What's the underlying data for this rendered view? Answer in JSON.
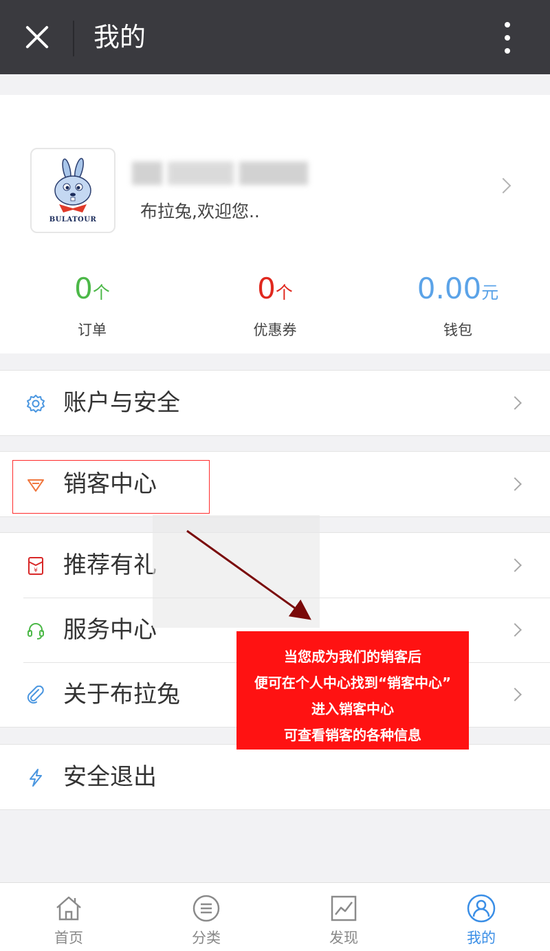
{
  "topbar": {
    "title": "我的"
  },
  "profile": {
    "avatar_text": "BULATOUR",
    "welcome": "布拉兔,欢迎您.."
  },
  "stats": [
    {
      "value": "0",
      "unit": "个",
      "label": "订单",
      "color": "#4cb848"
    },
    {
      "value": "0",
      "unit": "个",
      "label": "优惠券",
      "color": "#e0281e"
    },
    {
      "value": "0.00",
      "unit": "元",
      "label": "钱包",
      "color": "#5ba3e8"
    }
  ],
  "menu": {
    "account": {
      "label": "账户与安全",
      "icon": "gear-icon",
      "color": "#4a96e0"
    },
    "sales": {
      "label": "销客中心",
      "icon": "diamond-icon",
      "color": "#f07840"
    },
    "recommend": {
      "label": "推荐有礼",
      "icon": "red-envelope-icon",
      "color": "#d82828"
    },
    "service": {
      "label": "服务中心",
      "icon": "headset-icon",
      "color": "#4cb848"
    },
    "about": {
      "label": "关于布拉兔",
      "icon": "paperclip-icon",
      "color": "#4a96e0"
    },
    "logout": {
      "label": "安全退出",
      "icon": "lightning-icon",
      "color": "#4a96e0"
    }
  },
  "callout": {
    "lines": [
      "当您成为我们的销客后",
      "便可在个人中心找到“销客中心”",
      "进入销客中心",
      "可查看销客的各种信息"
    ],
    "color": "#ff1212"
  },
  "tabbar": {
    "tabs": [
      {
        "label": "首页",
        "icon": "home-icon"
      },
      {
        "label": "分类",
        "icon": "list-icon"
      },
      {
        "label": "发现",
        "icon": "chart-icon"
      },
      {
        "label": "我的",
        "icon": "user-icon",
        "active": true
      }
    ],
    "active_color": "#3a8ee6"
  }
}
